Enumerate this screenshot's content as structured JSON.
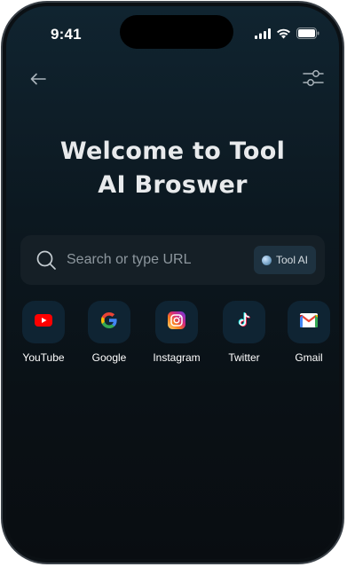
{
  "status_bar": {
    "time": "9:41",
    "icons": [
      "signal-icon",
      "wifi-icon",
      "battery-icon"
    ]
  },
  "header": {
    "back_icon": "arrow-left-icon",
    "filter_icon": "sliders-icon"
  },
  "welcome": {
    "line1": "Welcome to Tool",
    "line2": "AI Broswer"
  },
  "search": {
    "placeholder": "Search or type URL",
    "value": "",
    "badge_label": "Tool AI"
  },
  "shortcuts": [
    {
      "label": "YouTube",
      "icon": "youtube-icon"
    },
    {
      "label": "Google",
      "icon": "google-icon"
    },
    {
      "label": "Instagram",
      "icon": "instagram-icon"
    },
    {
      "label": "Twitter",
      "icon": "tiktok-icon"
    },
    {
      "label": "Gmail",
      "icon": "gmail-icon"
    }
  ],
  "colors": {
    "background": "#0b1116",
    "search_bg": "#151f26",
    "tile_bg": "#0f2433",
    "title": "#e8eaec"
  }
}
